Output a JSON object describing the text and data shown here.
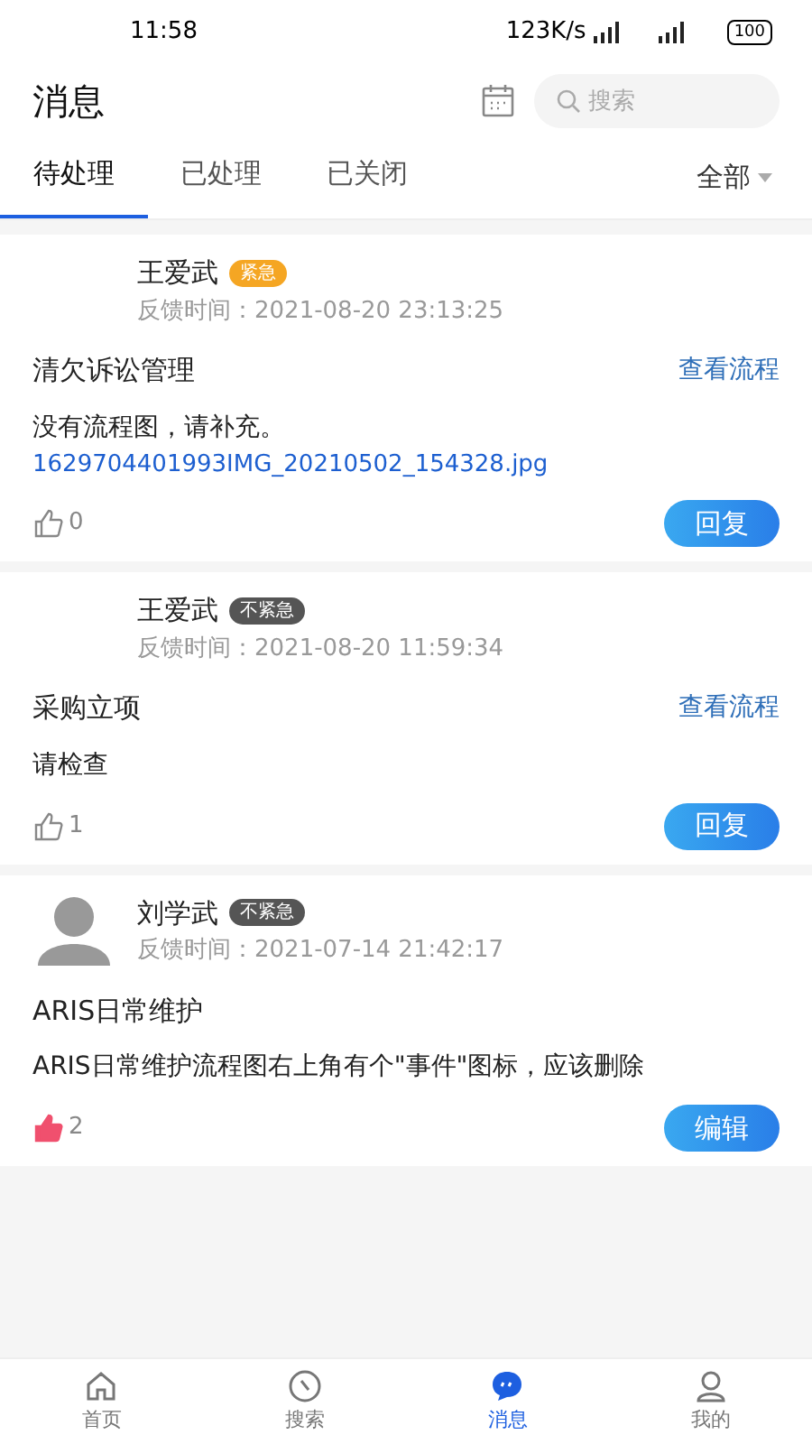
{
  "status_bar": {
    "time": "11:58",
    "speed": "123K/s",
    "battery": "100"
  },
  "header": {
    "title": "消息",
    "search": {
      "placeholder": "搜索"
    }
  },
  "tabs": [
    {
      "label": "待处理",
      "selected": true
    },
    {
      "label": "已处理",
      "selected": false
    },
    {
      "label": "已关闭",
      "selected": false
    }
  ],
  "filter": {
    "label": "全部"
  },
  "messages": [
    {
      "has_avatar": false,
      "name": "王爱武",
      "priority": "紧急",
      "urgent": true,
      "time": "反馈时间：2021-08-20 23:13:25",
      "title": "清欠诉讼管理",
      "link": "查看流程",
      "body": "没有流程图，请补充。",
      "attachment": "1629704401993IMG_20210502_154328.jpg",
      "liked": false,
      "likes": "0",
      "action": "回复"
    },
    {
      "has_avatar": false,
      "name": "王爱武",
      "priority": "不紧急",
      "urgent": false,
      "time": "反馈时间：2021-08-20 11:59:34",
      "title": "采购立项",
      "link": "查看流程",
      "body": "请检查",
      "liked": false,
      "likes": "1",
      "action": "回复"
    },
    {
      "has_avatar": true,
      "name": "刘学武",
      "priority": "不紧急",
      "urgent": false,
      "time": "反馈时间：2021-07-14 21:42:17",
      "title": "ARIS日常维护",
      "body": "ARIS日常维护流程图右上角有个\"事件\"图标，应该删除",
      "liked": true,
      "likes": "2",
      "action": "编辑"
    }
  ],
  "bottom_nav": [
    {
      "label": "首页",
      "kind": "home",
      "selected": false
    },
    {
      "label": "搜索",
      "kind": "search",
      "selected": false
    },
    {
      "label": "消息",
      "kind": "message",
      "selected": true
    },
    {
      "label": "我的",
      "kind": "profile",
      "selected": false
    }
  ]
}
